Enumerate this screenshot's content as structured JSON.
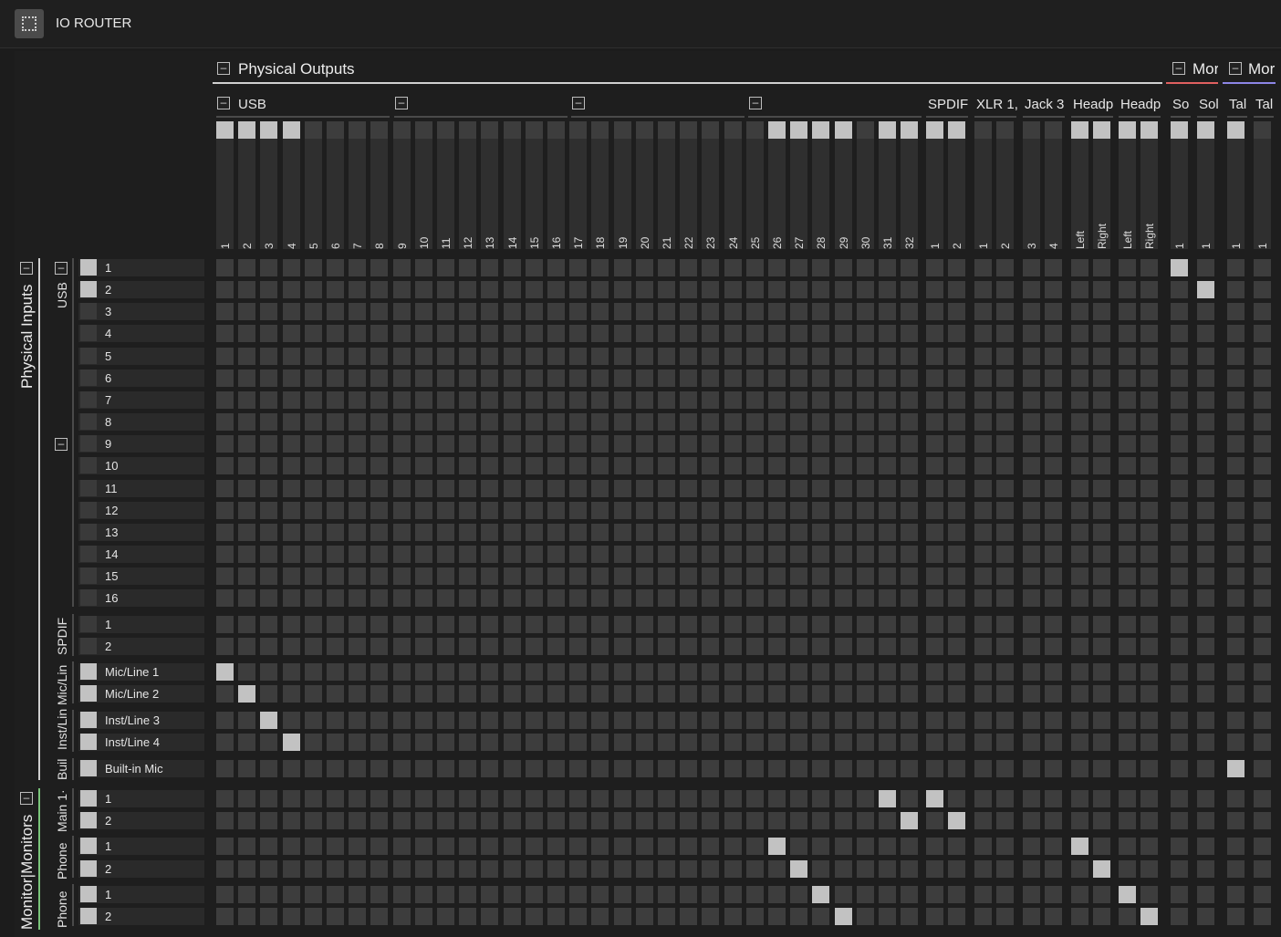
{
  "window": {
    "title": "IO ROUTER",
    "icon": "router-icon"
  },
  "colors": {
    "cell_on": "#c2c2c2",
    "cell_off": "#3d3d3d",
    "accent_white": "#d0d0d0",
    "accent_red": "#e06060",
    "accent_purple": "#8d86e6",
    "accent_green": "#7ac47a"
  },
  "collapse_glyph": "–",
  "outputs": {
    "group_label": "Physical Outputs",
    "top_groups": [
      {
        "label": "Physical Outputs",
        "color": "#d0d0d0"
      },
      {
        "label": "Mor",
        "color": "#e06060"
      },
      {
        "label": "Mor",
        "color": "#8d86e6"
      }
    ],
    "sub_groups": [
      {
        "label": "USB"
      },
      {
        "label": ""
      },
      {
        "label": ""
      },
      {
        "label": ""
      },
      {
        "label": "SPDIF"
      },
      {
        "label": "XLR 1,"
      },
      {
        "label": "Jack 3"
      },
      {
        "label": "Headp"
      },
      {
        "label": "Headp"
      },
      {
        "label": "So"
      },
      {
        "label": "Sol"
      },
      {
        "label": "Tal"
      },
      {
        "label": "Tal"
      }
    ],
    "columns": [
      {
        "label": "1",
        "on": true
      },
      {
        "label": "2",
        "on": true
      },
      {
        "label": "3",
        "on": true
      },
      {
        "label": "4",
        "on": true
      },
      {
        "label": "5",
        "on": false
      },
      {
        "label": "6",
        "on": false
      },
      {
        "label": "7",
        "on": false
      },
      {
        "label": "8",
        "on": false
      },
      {
        "label": "9",
        "on": false
      },
      {
        "label": "10",
        "on": false
      },
      {
        "label": "11",
        "on": false
      },
      {
        "label": "12",
        "on": false
      },
      {
        "label": "13",
        "on": false
      },
      {
        "label": "14",
        "on": false
      },
      {
        "label": "15",
        "on": false
      },
      {
        "label": "16",
        "on": false
      },
      {
        "label": "17",
        "on": false
      },
      {
        "label": "18",
        "on": false
      },
      {
        "label": "19",
        "on": false
      },
      {
        "label": "20",
        "on": false
      },
      {
        "label": "21",
        "on": false
      },
      {
        "label": "22",
        "on": false
      },
      {
        "label": "23",
        "on": false
      },
      {
        "label": "24",
        "on": false
      },
      {
        "label": "25",
        "on": false
      },
      {
        "label": "26",
        "on": true
      },
      {
        "label": "27",
        "on": true
      },
      {
        "label": "28",
        "on": true
      },
      {
        "label": "29",
        "on": true
      },
      {
        "label": "30",
        "on": false
      },
      {
        "label": "31",
        "on": true
      },
      {
        "label": "32",
        "on": true
      },
      {
        "label": "1",
        "on": true
      },
      {
        "label": "2",
        "on": true
      },
      {
        "label": "1",
        "on": false
      },
      {
        "label": "2",
        "on": false
      },
      {
        "label": "3",
        "on": false
      },
      {
        "label": "4",
        "on": false
      },
      {
        "label": "Left",
        "on": true
      },
      {
        "label": "Right",
        "on": true
      },
      {
        "label": "Left",
        "on": true
      },
      {
        "label": "Right",
        "on": true
      },
      {
        "label": "1",
        "on": true
      },
      {
        "label": "1",
        "on": true
      },
      {
        "label": "1",
        "on": true
      },
      {
        "label": "1",
        "on": false
      }
    ]
  },
  "inputs": {
    "groups": [
      {
        "label": "Physical Inputs",
        "color": "#d0d0d0"
      },
      {
        "label": "Monitor|Monitors",
        "color": "#7ac47a"
      }
    ],
    "sub_groups": [
      {
        "label": "USB"
      },
      {
        "label": "SPDIF"
      },
      {
        "label": "Mic/Lin"
      },
      {
        "label": "Inst/Lin"
      },
      {
        "label": "Buil"
      },
      {
        "label": "Main 1·"
      },
      {
        "label": "Phone"
      },
      {
        "label": "Phone"
      }
    ],
    "rows": [
      {
        "label": "1",
        "on": true
      },
      {
        "label": "2",
        "on": true
      },
      {
        "label": "3",
        "on": false
      },
      {
        "label": "4",
        "on": false
      },
      {
        "label": "5",
        "on": false
      },
      {
        "label": "6",
        "on": false
      },
      {
        "label": "7",
        "on": false
      },
      {
        "label": "8",
        "on": false
      },
      {
        "label": "9",
        "on": false
      },
      {
        "label": "10",
        "on": false
      },
      {
        "label": "11",
        "on": false
      },
      {
        "label": "12",
        "on": false
      },
      {
        "label": "13",
        "on": false
      },
      {
        "label": "14",
        "on": false
      },
      {
        "label": "15",
        "on": false
      },
      {
        "label": "16",
        "on": false
      },
      {
        "label": "1",
        "on": false
      },
      {
        "label": "2",
        "on": false
      },
      {
        "label": "Mic/Line 1",
        "on": true
      },
      {
        "label": "Mic/Line 2",
        "on": true
      },
      {
        "label": "Inst/Line 3",
        "on": true
      },
      {
        "label": "Inst/Line 4",
        "on": true
      },
      {
        "label": "Built-in Mic",
        "on": true
      },
      {
        "label": "1",
        "on": true
      },
      {
        "label": "2",
        "on": true
      },
      {
        "label": "1",
        "on": true
      },
      {
        "label": "2",
        "on": true
      },
      {
        "label": "1",
        "on": true
      },
      {
        "label": "2",
        "on": true
      }
    ]
  },
  "routes": [
    {
      "row": 0,
      "col": 42
    },
    {
      "row": 1,
      "col": 43
    },
    {
      "row": 18,
      "col": 0
    },
    {
      "row": 19,
      "col": 1
    },
    {
      "row": 20,
      "col": 2
    },
    {
      "row": 21,
      "col": 3
    },
    {
      "row": 22,
      "col": 44
    },
    {
      "row": 23,
      "col": 30
    },
    {
      "row": 23,
      "col": 32
    },
    {
      "row": 24,
      "col": 31
    },
    {
      "row": 24,
      "col": 33
    },
    {
      "row": 25,
      "col": 25
    },
    {
      "row": 25,
      "col": 38
    },
    {
      "row": 26,
      "col": 26
    },
    {
      "row": 26,
      "col": 39
    },
    {
      "row": 27,
      "col": 27
    },
    {
      "row": 27,
      "col": 40
    },
    {
      "row": 28,
      "col": 28
    },
    {
      "row": 28,
      "col": 41
    }
  ]
}
